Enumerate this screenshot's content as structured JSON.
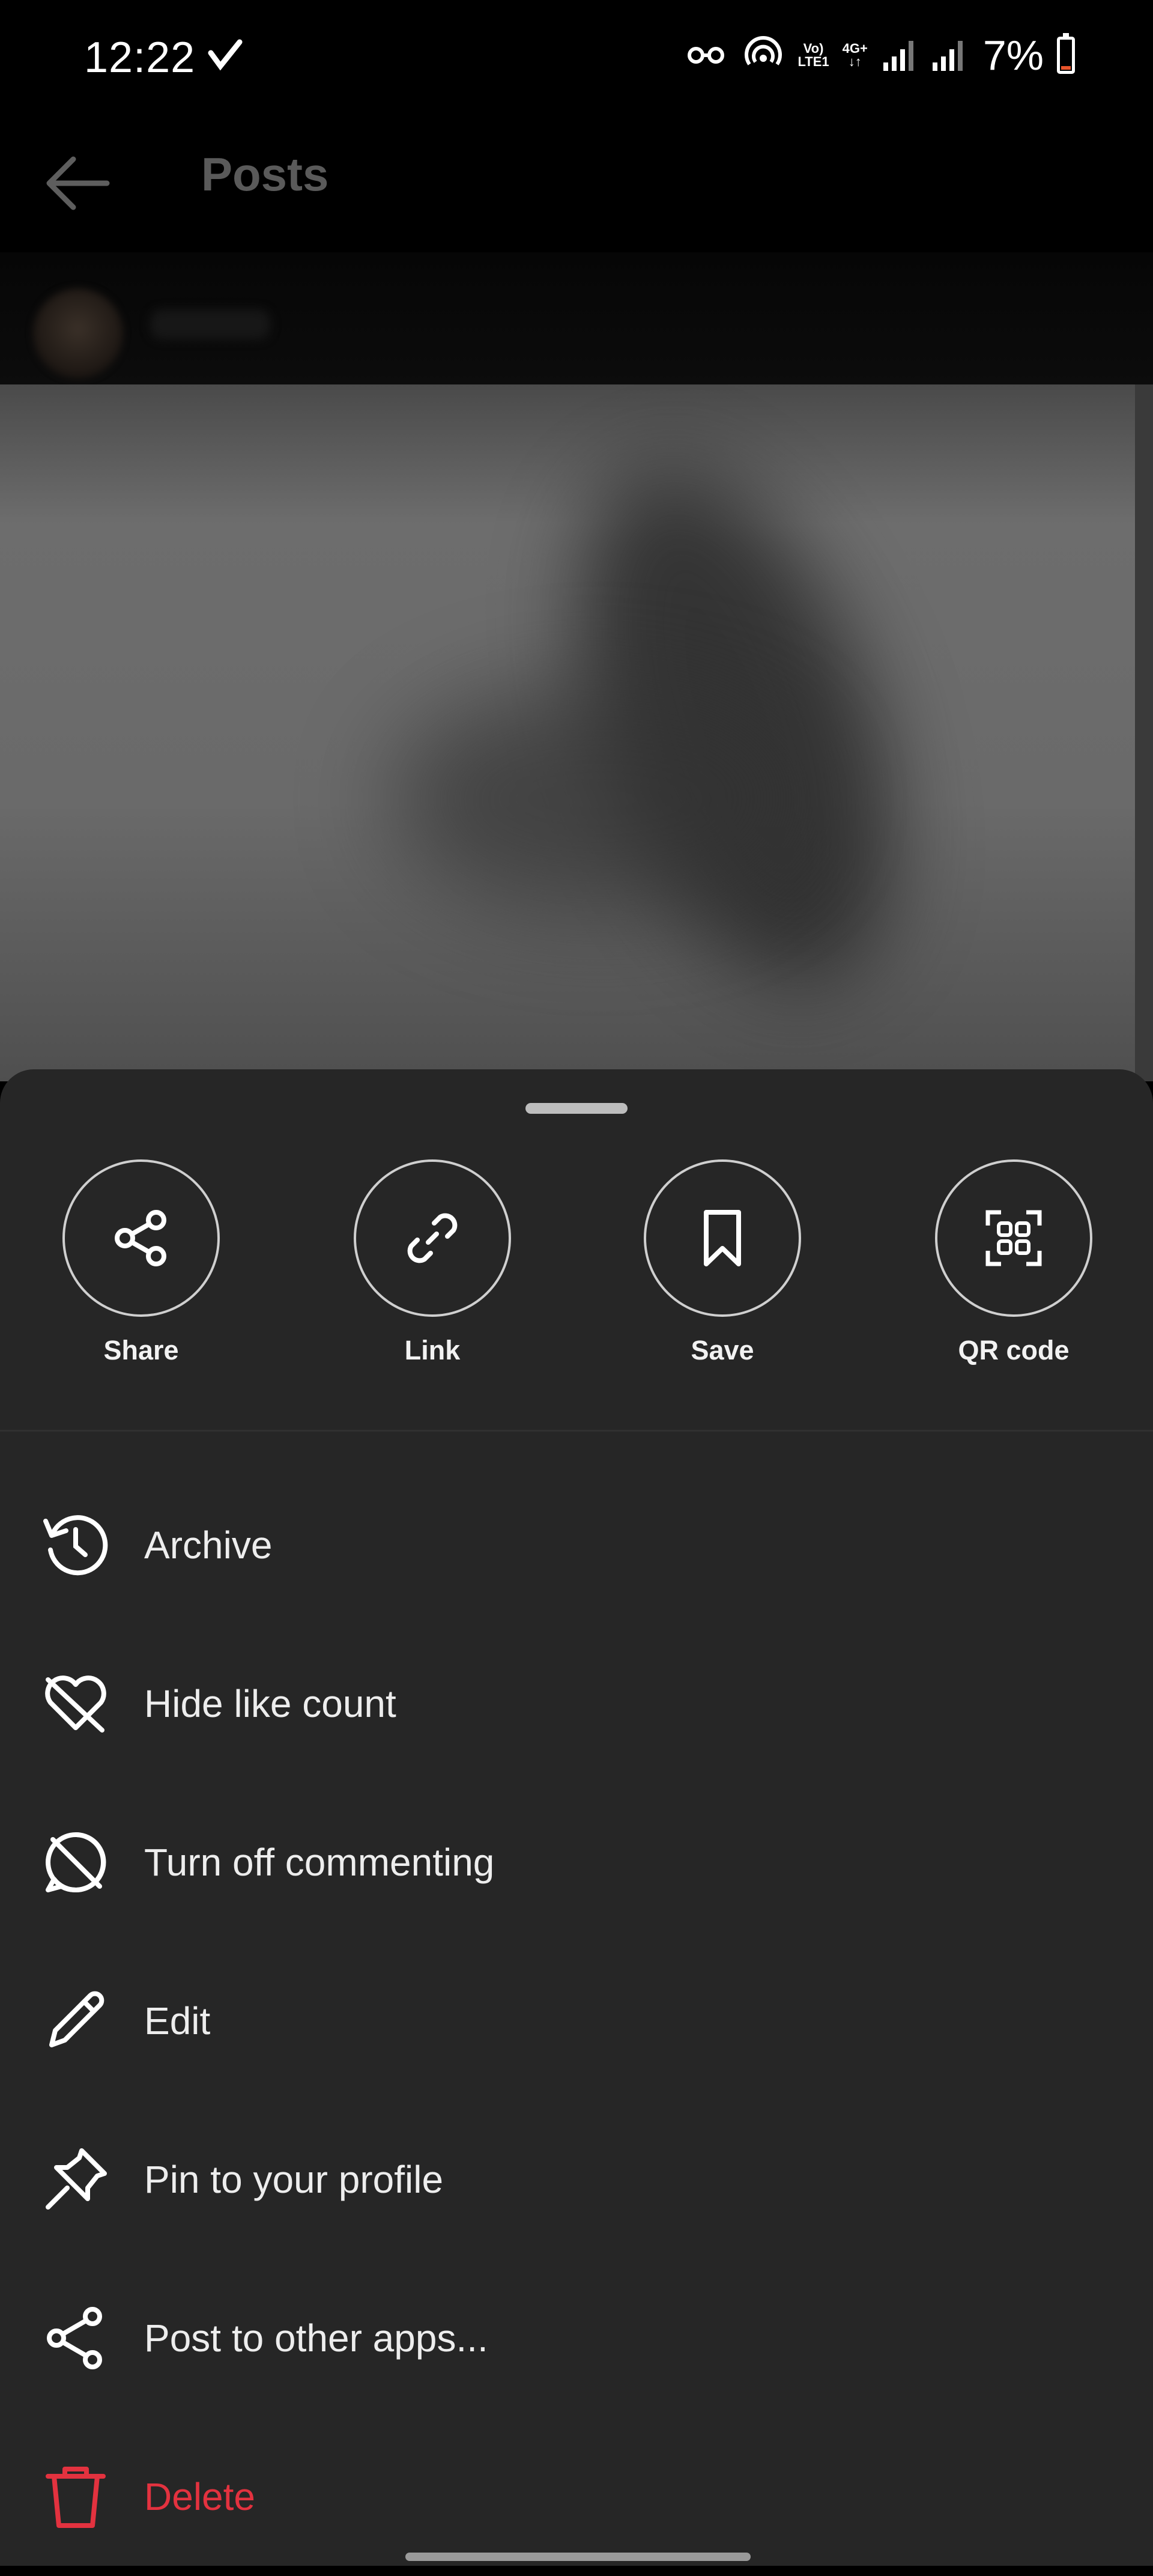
{
  "status_bar": {
    "time": "12:22",
    "network_label_top": "Vo)",
    "network_label_bottom": "LTE1",
    "signal_label_top": "4G+",
    "signal_label_bottom": "↓↑",
    "battery_percent": "7%",
    "battery_level": 0.07
  },
  "app_bar": {
    "title": "Posts"
  },
  "sheet": {
    "quick_actions": [
      {
        "label": "Share",
        "icon": "share-icon"
      },
      {
        "label": "Link",
        "icon": "link-icon"
      },
      {
        "label": "Save",
        "icon": "bookmark-icon"
      },
      {
        "label": "QR code",
        "icon": "qr-code-icon"
      }
    ],
    "menu_items": [
      {
        "label": "Archive",
        "icon": "archive-icon"
      },
      {
        "label": "Hide like count",
        "icon": "heart-off-icon"
      },
      {
        "label": "Turn off commenting",
        "icon": "comment-off-icon"
      },
      {
        "label": "Edit",
        "icon": "pencil-icon"
      },
      {
        "label": "Pin to your profile",
        "icon": "pin-icon"
      },
      {
        "label": "Post to other apps...",
        "icon": "share-icon"
      },
      {
        "label": "Delete",
        "icon": "trash-icon"
      }
    ]
  },
  "colors": {
    "sheet_background": "#262626",
    "danger": "#e3323f",
    "text": "#ededed"
  }
}
